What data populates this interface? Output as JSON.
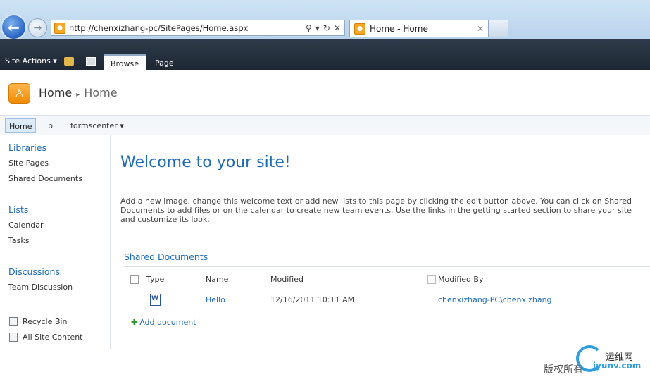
{
  "browser": {
    "address_url": "http://chenxizhang-pc/SitePages/Home.aspx",
    "tab_title": "Home - Home",
    "back_icon": "back-arrow-icon",
    "forward_icon": "forward-arrow-icon",
    "search_icon": "search-icon",
    "refresh_icon": "refresh-icon",
    "stop_icon": "close-icon"
  },
  "ribbon": {
    "site_actions": "Site Actions",
    "tabs": [
      "Browse",
      "Page"
    ]
  },
  "title_area": {
    "site_title": "Home",
    "breadcrumb_separator": "▸",
    "page_title": "Home"
  },
  "topnav": {
    "items": [
      "Home",
      "bi",
      "formscenter"
    ]
  },
  "quicklaunch": {
    "libraries_heading": "Libraries",
    "libraries": [
      "Site Pages",
      "Shared Documents"
    ],
    "lists_heading": "Lists",
    "lists": [
      "Calendar",
      "Tasks"
    ],
    "discussions_heading": "Discussions",
    "discussions": [
      "Team Discussion"
    ],
    "recycle_bin": "Recycle Bin",
    "all_site_content": "All Site Content"
  },
  "main": {
    "welcome": "Welcome to your site!",
    "intro_lines": [
      "Add a new image, change this welcome text or add new lists to this page by clicking the edit button above. You can click on Shared",
      "Documents to add files or on the calendar to create new team events. Use the links in the getting started section to share your site",
      "and customize its look."
    ],
    "web_part_title": "Shared Documents",
    "columns": [
      "Type",
      "Name",
      "Modified",
      "Modified By"
    ],
    "rows": [
      {
        "name": "Hello",
        "modified": "12/16/2011 10:11 AM",
        "modified_by": "chenxizhang-PC\\chenxizhang"
      }
    ],
    "add_document": "Add document"
  },
  "watermark": {
    "brand": "运维网",
    "text": "版权所有",
    "url": "iyunv.com"
  },
  "colors": {
    "accent": "#1e6bb8",
    "ribbon": "#1d2733"
  }
}
